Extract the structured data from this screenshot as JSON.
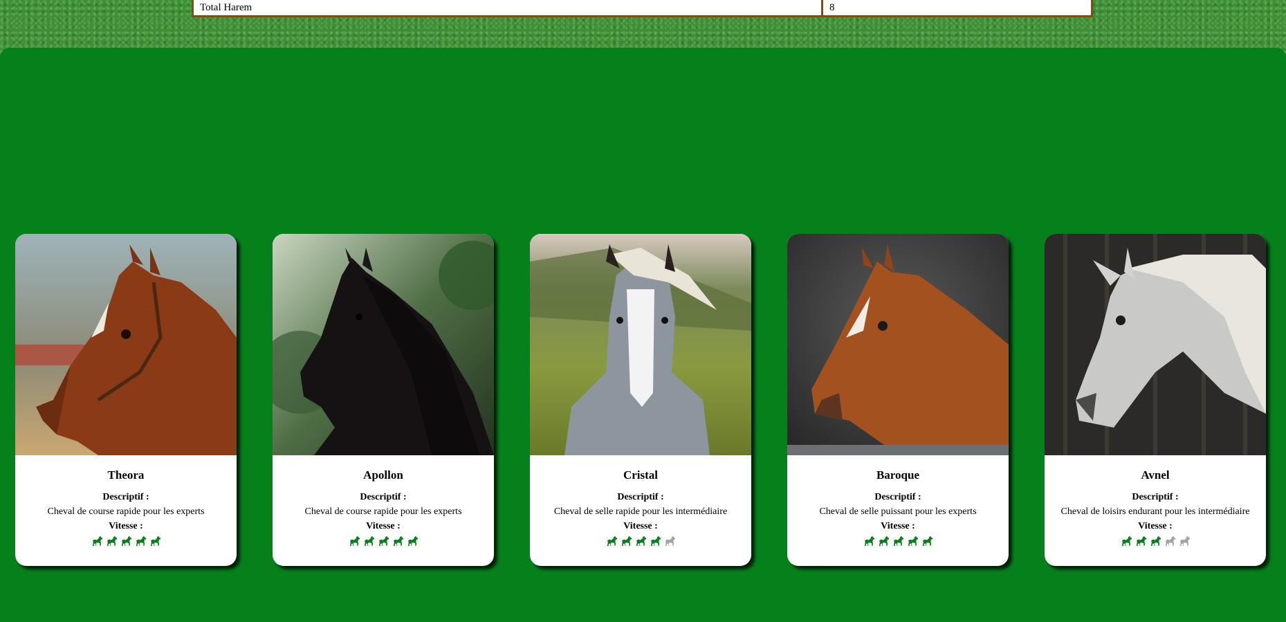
{
  "summary": {
    "label": "Total Harem",
    "value": "8"
  },
  "colors": {
    "speed_on": "#0b7d1d",
    "speed_off": "#a3a3a3",
    "panel": "#05801b"
  },
  "cards": [
    {
      "name": "Theora",
      "desc_label": "Descriptif :",
      "description": "Cheval de course rapide pour les experts",
      "speed_label": "Vitesse :",
      "speed": 5,
      "max_speed": 5,
      "photo": "chestnut-horse-bridle-photo"
    },
    {
      "name": "Apollon",
      "desc_label": "Descriptif :",
      "description": "Cheval de course rapide pour les experts",
      "speed_label": "Vitesse :",
      "speed": 5,
      "max_speed": 5,
      "photo": "black-horse-photo"
    },
    {
      "name": "Cristal",
      "desc_label": "Descriptif :",
      "description": "Cheval de selle rapide pour les intermédiaire",
      "speed_label": "Vitesse :",
      "speed": 4,
      "max_speed": 5,
      "photo": "dapple-grey-horse-photo"
    },
    {
      "name": "Baroque",
      "desc_label": "Descriptif :",
      "description": "Cheval de selle puissant pour les experts",
      "speed_label": "Vitesse :",
      "speed": 5,
      "max_speed": 5,
      "photo": "chestnut-horse-stable-photo"
    },
    {
      "name": "Avnel",
      "desc_label": "Descriptif :",
      "description": "Cheval de loisirs endurant pour les intermédiaire",
      "speed_label": "Vitesse :",
      "speed": 3,
      "max_speed": 5,
      "photo": "white-horse-barn-photo"
    }
  ]
}
